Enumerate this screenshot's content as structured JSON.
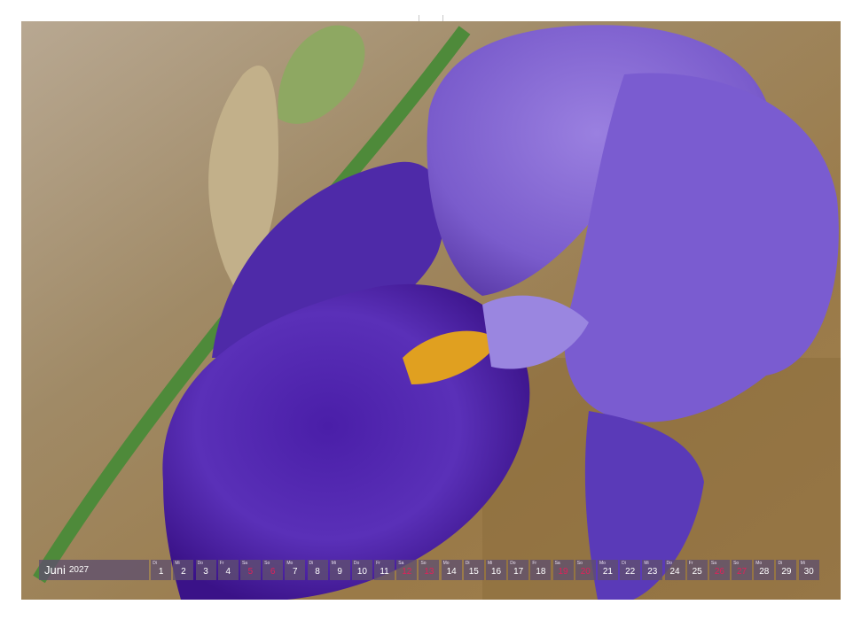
{
  "photo": {
    "subject": "purple bearded iris flower with green stem and buds",
    "colors": {
      "petal": "#5a2fb0",
      "petal_light": "#8a6ad8",
      "stem": "#4e8a3a",
      "background": "#9a7a52",
      "beard": "#e0a020"
    }
  },
  "calendar": {
    "month": "Juni",
    "year": "2027",
    "weekend_color": "#e0205a",
    "days": [
      {
        "wd": "Di",
        "num": "1",
        "weekend": false
      },
      {
        "wd": "Mi",
        "num": "2",
        "weekend": false
      },
      {
        "wd": "Do",
        "num": "3",
        "weekend": false
      },
      {
        "wd": "Fr",
        "num": "4",
        "weekend": false
      },
      {
        "wd": "Sa",
        "num": "5",
        "weekend": true
      },
      {
        "wd": "So",
        "num": "6",
        "weekend": true
      },
      {
        "wd": "Mo",
        "num": "7",
        "weekend": false
      },
      {
        "wd": "Di",
        "num": "8",
        "weekend": false
      },
      {
        "wd": "Mi",
        "num": "9",
        "weekend": false
      },
      {
        "wd": "Do",
        "num": "10",
        "weekend": false
      },
      {
        "wd": "Fr",
        "num": "11",
        "weekend": false
      },
      {
        "wd": "Sa",
        "num": "12",
        "weekend": true
      },
      {
        "wd": "So",
        "num": "13",
        "weekend": true
      },
      {
        "wd": "Mo",
        "num": "14",
        "weekend": false
      },
      {
        "wd": "Di",
        "num": "15",
        "weekend": false
      },
      {
        "wd": "Mi",
        "num": "16",
        "weekend": false
      },
      {
        "wd": "Do",
        "num": "17",
        "weekend": false
      },
      {
        "wd": "Fr",
        "num": "18",
        "weekend": false
      },
      {
        "wd": "Sa",
        "num": "19",
        "weekend": true
      },
      {
        "wd": "So",
        "num": "20",
        "weekend": true
      },
      {
        "wd": "Mo",
        "num": "21",
        "weekend": false
      },
      {
        "wd": "Di",
        "num": "22",
        "weekend": false
      },
      {
        "wd": "Mi",
        "num": "23",
        "weekend": false
      },
      {
        "wd": "Do",
        "num": "24",
        "weekend": false
      },
      {
        "wd": "Fr",
        "num": "25",
        "weekend": false
      },
      {
        "wd": "Sa",
        "num": "26",
        "weekend": true
      },
      {
        "wd": "So",
        "num": "27",
        "weekend": true
      },
      {
        "wd": "Mo",
        "num": "28",
        "weekend": false
      },
      {
        "wd": "Di",
        "num": "29",
        "weekend": false
      },
      {
        "wd": "Mi",
        "num": "30",
        "weekend": false
      }
    ]
  }
}
